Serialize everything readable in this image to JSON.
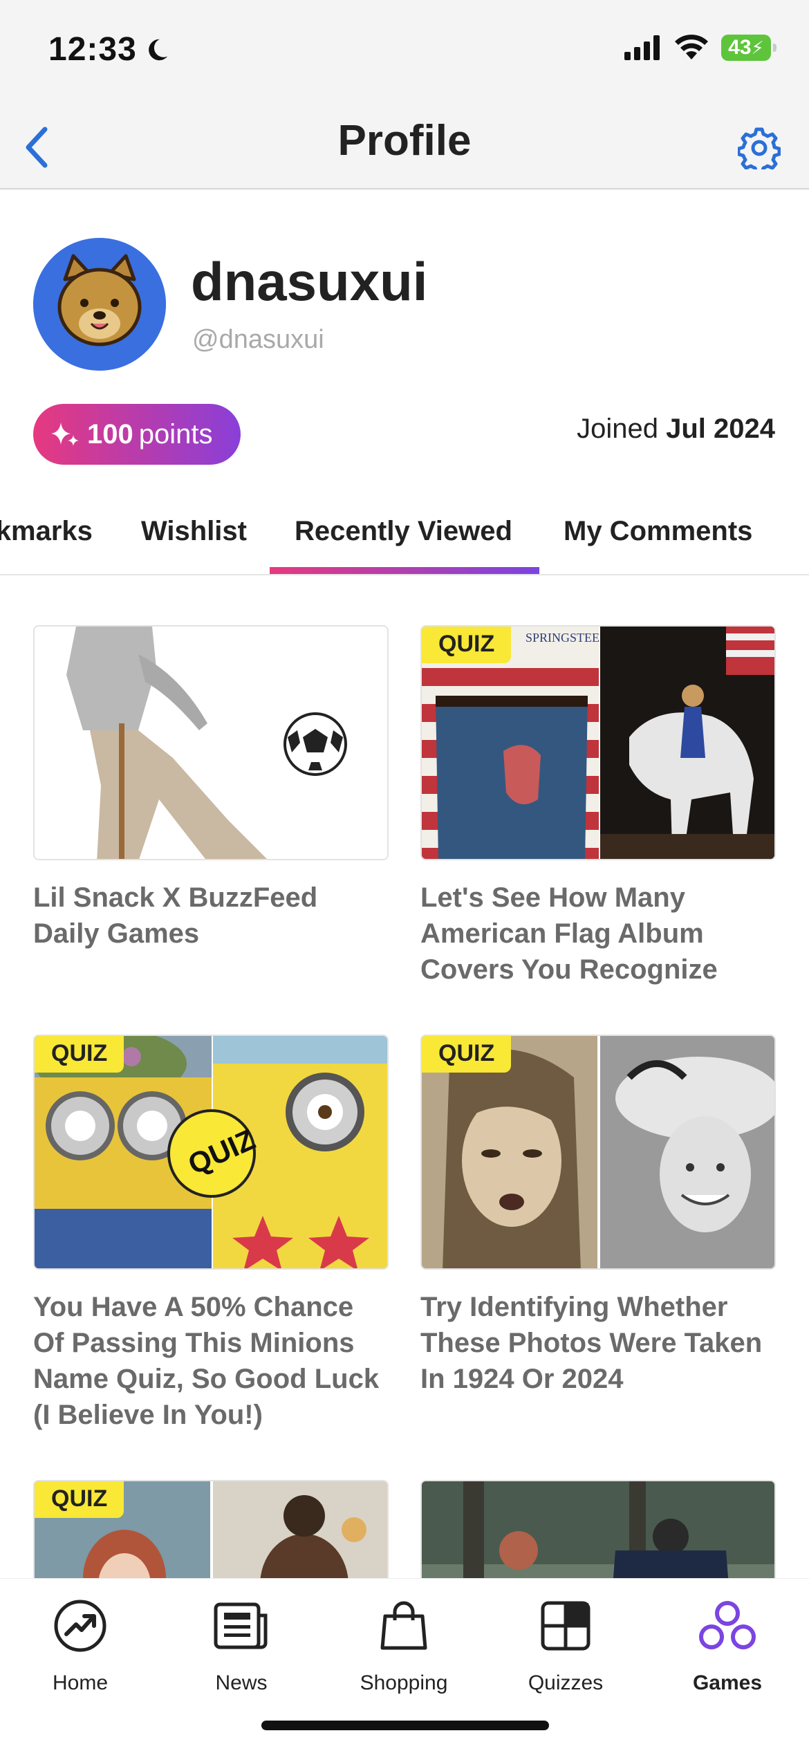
{
  "status_bar": {
    "time": "12:33",
    "battery": "43"
  },
  "header": {
    "title": "Profile"
  },
  "profile": {
    "username": "dnasuxui",
    "handle": "@dnasuxui",
    "points_value": "100",
    "points_label": "points",
    "joined_label": "Joined",
    "joined_date": "Jul 2024"
  },
  "tabs": [
    {
      "label": "Bookmarks"
    },
    {
      "label": "Wishlist"
    },
    {
      "label": "Recently Viewed"
    },
    {
      "label": "My Comments"
    }
  ],
  "items": [
    {
      "tag": "",
      "title": "Lil Snack X BuzzFeed Daily Games"
    },
    {
      "tag": "QUIZ",
      "title": "Let's See How Many American Flag Album Covers You Recognize"
    },
    {
      "tag": "QUIZ",
      "title": "You Have A 50% Chance Of Passing This Minions Name Quiz, So Good Luck (I Believe In You!)"
    },
    {
      "tag": "QUIZ",
      "title": "Try Identifying Whether These Photos Were Taken In 1924 Or 2024"
    },
    {
      "tag": "QUIZ",
      "title": ""
    },
    {
      "tag": "",
      "title": ""
    }
  ],
  "thumb_text": {
    "quiz_sticker": "QUIZ",
    "album_text": "SPRINGSTEEN"
  },
  "tab_bar": [
    {
      "label": "Home",
      "icon": "trending-icon"
    },
    {
      "label": "News",
      "icon": "newspaper-icon"
    },
    {
      "label": "Shopping",
      "icon": "shopping-bag-icon"
    },
    {
      "label": "Quizzes",
      "icon": "grid-icon"
    },
    {
      "label": "Games",
      "icon": "games-icon"
    }
  ],
  "colors": {
    "accent_blue": "#2b6fd8",
    "quiz_yellow": "#f9e835",
    "pink": "#e6397f",
    "purple": "#7a45e0"
  }
}
